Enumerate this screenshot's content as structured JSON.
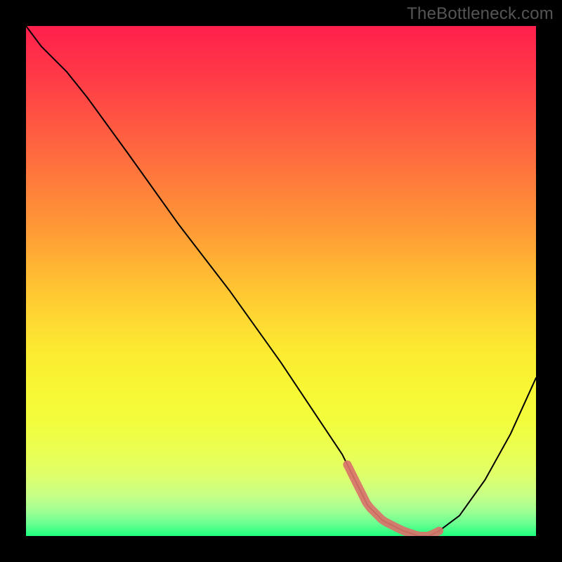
{
  "watermark": {
    "text": "TheBottleneck.com"
  },
  "chart_data": {
    "type": "line",
    "title": "",
    "xlabel": "",
    "ylabel": "",
    "xlim": [
      0,
      100
    ],
    "ylim": [
      0,
      100
    ],
    "grid": false,
    "legend": false,
    "series": [
      {
        "name": "curve",
        "x": [
          0,
          3,
          6,
          8,
          12,
          20,
          30,
          40,
          50,
          58,
          62,
          65,
          67,
          70,
          74,
          77,
          79,
          81,
          85,
          90,
          95,
          100
        ],
        "y": [
          100,
          96,
          93,
          91,
          86,
          75,
          61,
          48,
          34,
          22,
          16,
          10,
          6,
          3,
          1,
          0,
          0,
          1,
          4,
          11,
          20,
          31
        ]
      }
    ],
    "highlight_band": {
      "x_start": 63,
      "x_end": 81,
      "color": "#d9736a"
    },
    "background_gradient": {
      "stops": [
        {
          "offset": 0.0,
          "color": "#ff1f4c"
        },
        {
          "offset": 0.1,
          "color": "#ff3a47"
        },
        {
          "offset": 0.2,
          "color": "#ff5a42"
        },
        {
          "offset": 0.3,
          "color": "#ff7a3c"
        },
        {
          "offset": 0.4,
          "color": "#ff9a36"
        },
        {
          "offset": 0.48,
          "color": "#ffb833"
        },
        {
          "offset": 0.56,
          "color": "#ffd432"
        },
        {
          "offset": 0.64,
          "color": "#fceb31"
        },
        {
          "offset": 0.72,
          "color": "#f7f835"
        },
        {
          "offset": 0.78,
          "color": "#f2fd3e"
        },
        {
          "offset": 0.84,
          "color": "#e9ff55"
        },
        {
          "offset": 0.885,
          "color": "#ddff6d"
        },
        {
          "offset": 0.92,
          "color": "#c7ff86"
        },
        {
          "offset": 0.95,
          "color": "#a2ff93"
        },
        {
          "offset": 0.975,
          "color": "#6bff91"
        },
        {
          "offset": 1.0,
          "color": "#1eff7e"
        }
      ]
    }
  }
}
